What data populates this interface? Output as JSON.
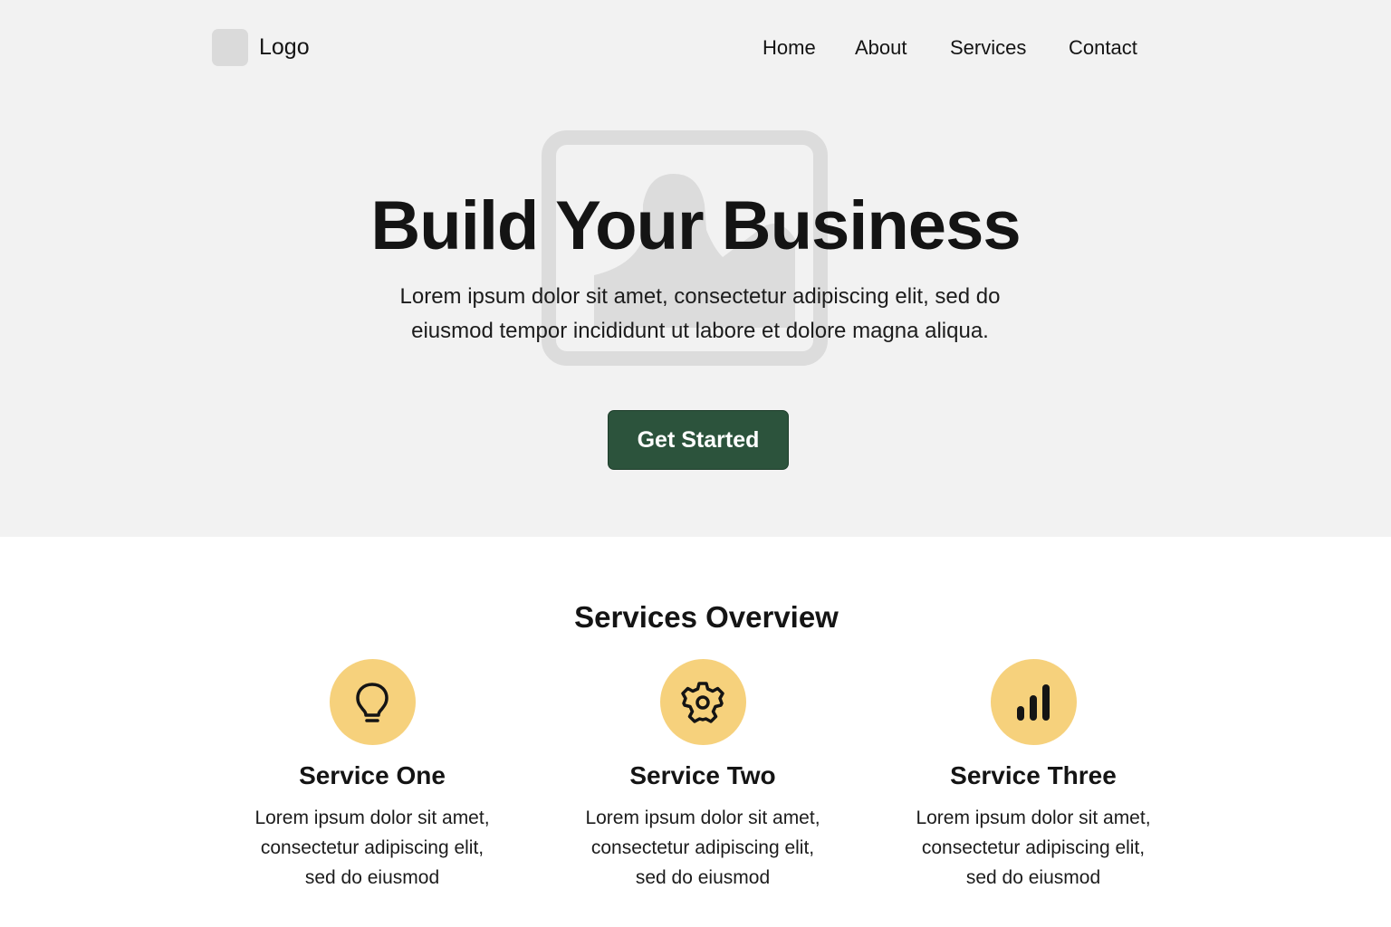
{
  "header": {
    "logo_text": "Logo",
    "nav": [
      {
        "label": "Home"
      },
      {
        "label": "About"
      },
      {
        "label": "Services"
      },
      {
        "label": "Contact"
      }
    ]
  },
  "hero": {
    "title": "Build Your Business",
    "subtitle": "Lorem ipsum dolor sit amet, consectetur adipiscing elit, sed do eiusmod tempor incididunt ut labore et dolore magna aliqua.",
    "cta_label": "Get Started",
    "background_icon": "image-placeholder-icon"
  },
  "services": {
    "heading": "Services Overview",
    "items": [
      {
        "icon": "lightbulb-icon",
        "title": "Service One",
        "description": "Lorem ipsum dolor sit amet, consectetur adipiscing elit, sed do eiusmod"
      },
      {
        "icon": "gear-icon",
        "title": "Service Two",
        "description": "Lorem ipsum dolor sit amet, consectetur adipiscing elit, sed do eiusmod"
      },
      {
        "icon": "bar-chart-icon",
        "title": "Service Three",
        "description": "Lorem ipsum dolor sit amet, consectetur adipiscing elit, sed do eiusmod"
      }
    ]
  },
  "colors": {
    "hero_background": "#f2f2f2",
    "accent_green": "#2c533c",
    "icon_circle": "#f6d17c",
    "text": "#141414"
  }
}
